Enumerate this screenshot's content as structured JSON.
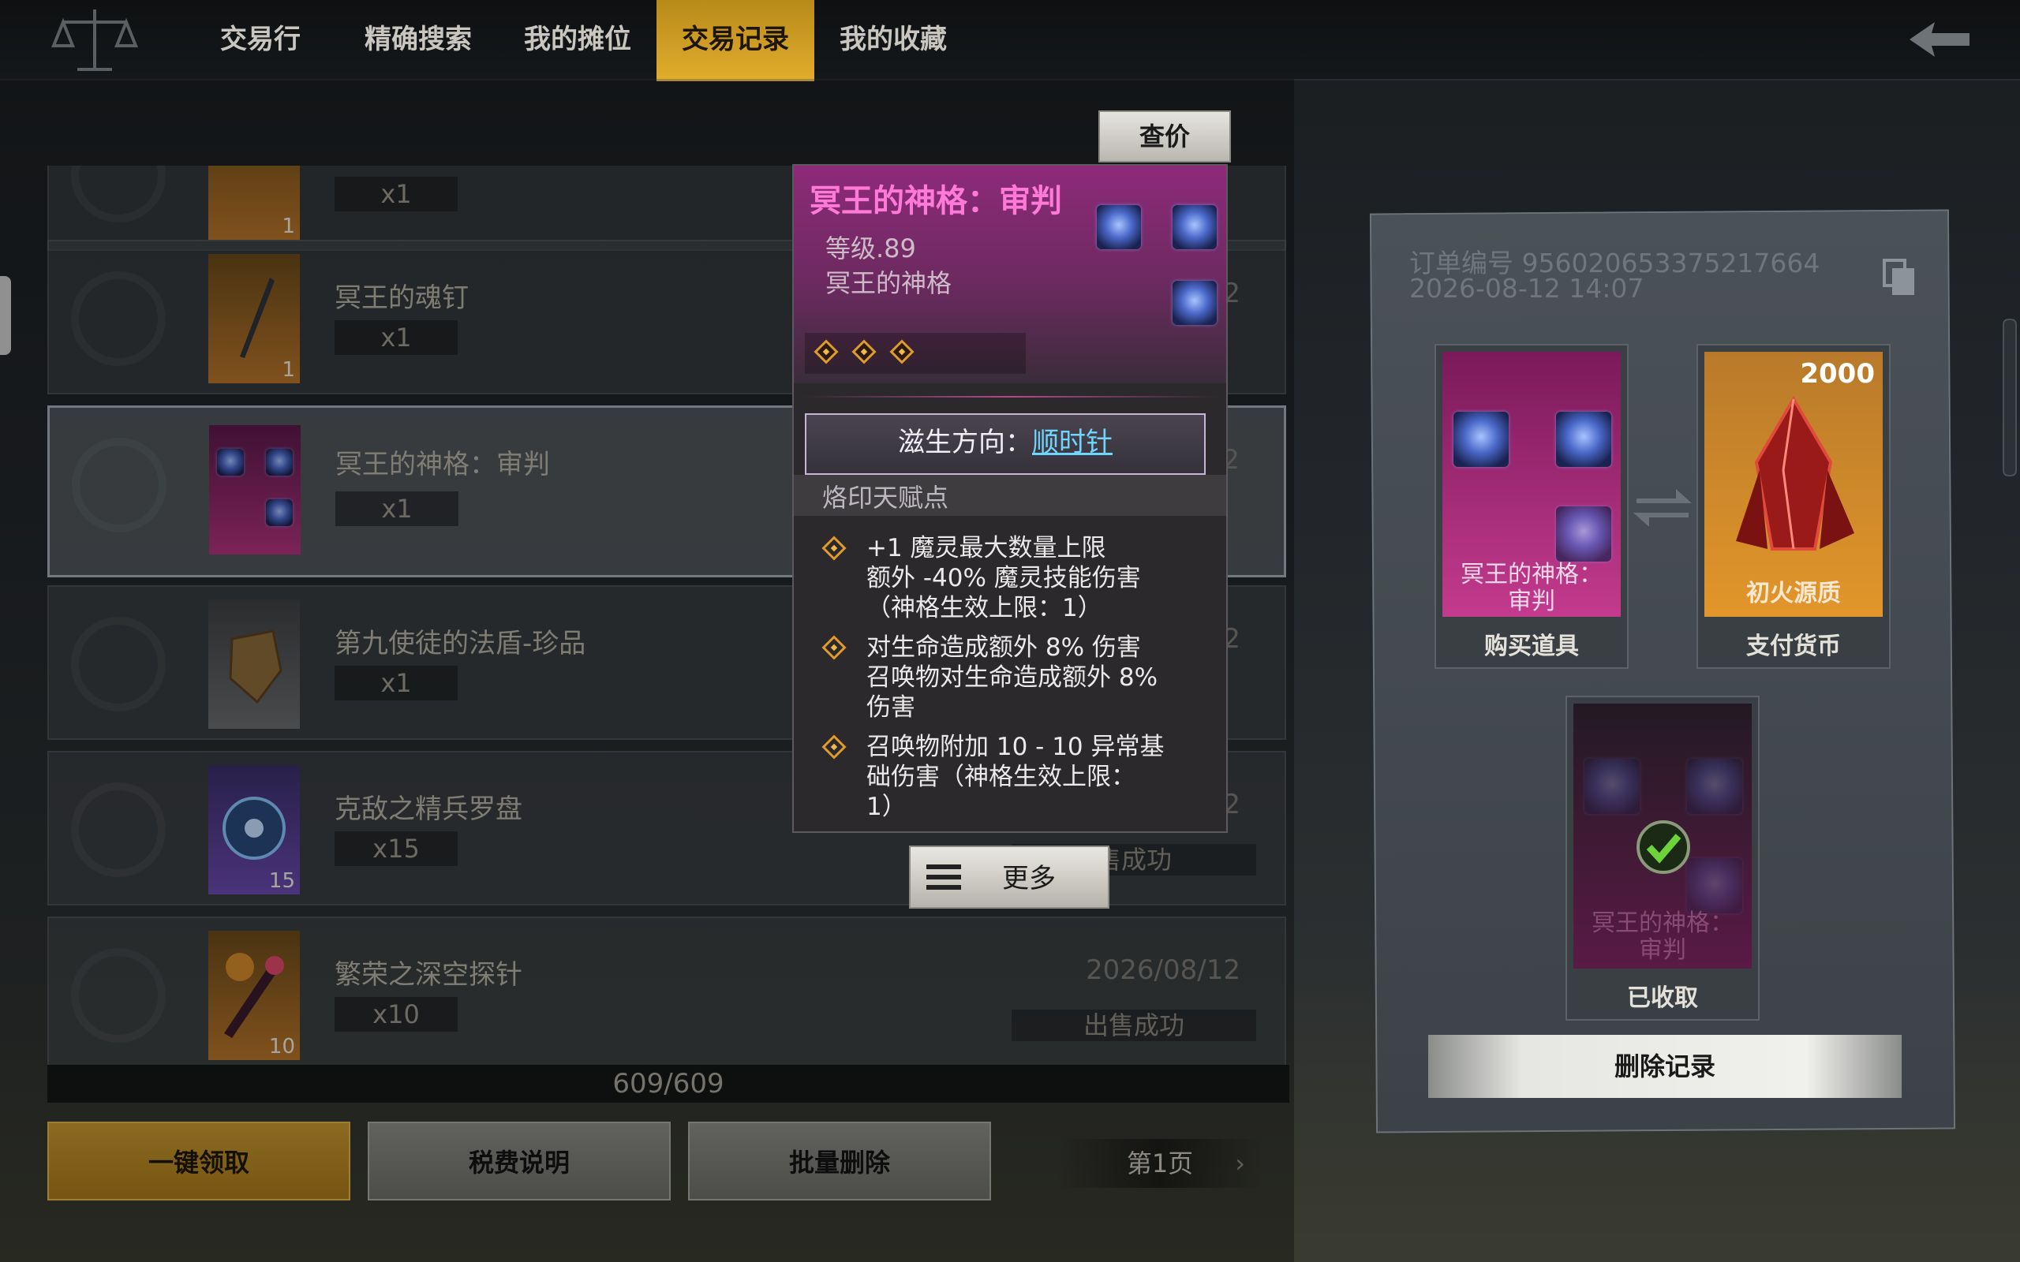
{
  "nav": {
    "tabs": [
      {
        "label": "交易行",
        "active": false
      },
      {
        "label": "精确搜索",
        "active": false
      },
      {
        "label": "我的摊位",
        "active": false
      },
      {
        "label": "交易记录",
        "active": true
      },
      {
        "label": "我的收藏",
        "active": false
      }
    ],
    "logo_icon": "scales-icon",
    "back_icon": "back-arrow-icon"
  },
  "price_check_label": "查价",
  "records": [
    {
      "name": "",
      "qty": "x1",
      "count_badge": "1",
      "date": "",
      "status": "",
      "thumb_color": "#8a5a1a"
    },
    {
      "name": "冥王的魂钉",
      "qty": "x1",
      "count_badge": "1",
      "date": "2",
      "status": "",
      "thumb_color": "#8a5a1a"
    },
    {
      "name": "冥王的神格：审判",
      "qty": "x1",
      "count_badge": "",
      "date": "2",
      "status": "",
      "thumb_color": "#7a1a5e",
      "selected": true
    },
    {
      "name": "第九使徒的法盾-珍品",
      "qty": "x1",
      "count_badge": "",
      "date": "2",
      "status": "",
      "thumb_color": "#55575a"
    },
    {
      "name": "克敌之精兵罗盘",
      "qty": "x15",
      "count_badge": "15",
      "date": "2",
      "status": "售成功",
      "thumb_color": "#4a3a7a"
    },
    {
      "name": "繁荣之深空探针",
      "qty": "x10",
      "count_badge": "10",
      "date": "2026/08/12",
      "status": "出售成功",
      "thumb_color": "#8a5a1a"
    }
  ],
  "counter": "609/609",
  "bottom_buttons": {
    "claim_all": "一键领取",
    "tax_info": "税费说明",
    "batch_delete": "批量删除"
  },
  "page_indicator": "第1页",
  "tooltip": {
    "title": "冥王的神格：审判",
    "level": "等级.89",
    "type": "冥王的神格",
    "direction_label": "滋生方向：",
    "direction_value": "顺时针",
    "section_label": "烙印天赋点",
    "talents": [
      {
        "text": "+1 魔灵最大数量上限\n额外 -40% 魔灵技能伤害\n（神格生效上限：1）"
      },
      {
        "text": "对生命造成额外 8% 伤害\n召唤物对生命造成额外 8%\n伤害"
      },
      {
        "text": "召唤物附加 10 - 10 异常基\n础伤害（神格生效上限：\n1）"
      }
    ],
    "more_label": "更多"
  },
  "order": {
    "id_line": "订单编号 956020653375217664",
    "time_line": "2026-08-12 14:07",
    "buy_item": {
      "inner_label": "冥王的神格：\n审判",
      "caption": "购买道具"
    },
    "currency": {
      "amount": "2000",
      "inner_label": "初火源质",
      "caption": "支付货币"
    },
    "received": {
      "inner_label": "冥王的神格：\n审判",
      "caption": "已收取"
    },
    "delete_label": "删除记录"
  },
  "colors": {
    "active_tab": "#e0ac2c",
    "tooltip_title": "#ff7ad6",
    "direction_value": "#6fd6ff",
    "talent_diamond": "#e09b2a"
  }
}
